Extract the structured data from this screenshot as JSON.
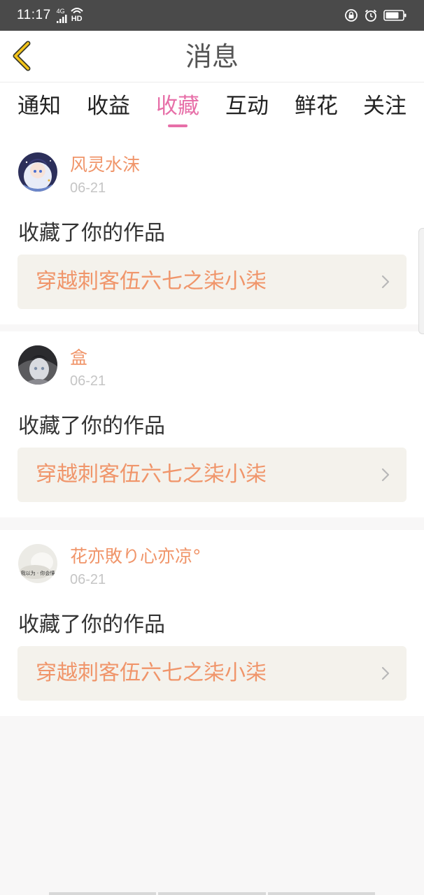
{
  "status_bar": {
    "time": "11:17",
    "network": "4G",
    "hd": "HD",
    "icons": [
      "signal-icon",
      "wifi-icon",
      "lock-rotation-icon",
      "alarm-icon",
      "battery-icon"
    ]
  },
  "header": {
    "title": "消息",
    "back_icon": "chevron-left-icon",
    "accent_color": "#f5c518"
  },
  "tabs": {
    "items": [
      {
        "label": "通知"
      },
      {
        "label": "收益"
      },
      {
        "label": "收藏"
      },
      {
        "label": "互动"
      },
      {
        "label": "鲜花"
      },
      {
        "label": "关注"
      }
    ],
    "active_index": 2,
    "active_color": "#e76fa8"
  },
  "notifications": [
    {
      "username": "风灵水沫",
      "date": "06-21",
      "action": "收藏了你的作品",
      "work_title": "穿越刺客伍六七之柒小柒"
    },
    {
      "username": "盒",
      "date": "06-21",
      "action": "收藏了你的作品",
      "work_title": "穿越刺客伍六七之柒小柒"
    },
    {
      "username": "花亦敗り心亦凉°",
      "date": "06-21",
      "action": "收藏了你的作品",
      "work_title": "穿越刺客伍六七之柒小柒",
      "avatar_text": "我以为 · 你会懂"
    }
  ],
  "colors": {
    "username": "#f0956a",
    "work_link_bg": "#f4f2ec",
    "page_bg": "#f8f7f7"
  }
}
